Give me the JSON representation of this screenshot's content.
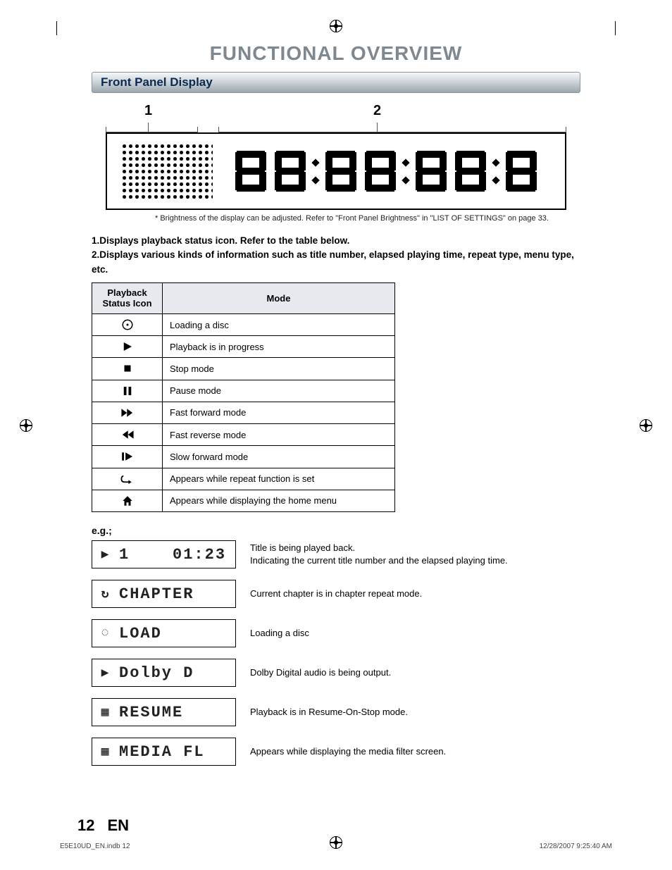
{
  "header": {
    "title": "FUNCTIONAL OVERVIEW"
  },
  "section": {
    "title": "Front Panel Display"
  },
  "diagram": {
    "labels": {
      "l1": "1",
      "l2": "2"
    }
  },
  "foot_note": "*  Brightness of the display can be adjusted. Refer to \"Front Panel Brightness\" in \"LIST OF SETTINGS\" on page 33.",
  "desc_list": {
    "item1": "1.Displays playback status icon. Refer to the table below.",
    "item2": "2.Displays various kinds of information such as title number, elapsed playing time, repeat type, menu type, etc."
  },
  "table": {
    "head": {
      "icon": "Playback Status Icon",
      "mode": "Mode"
    },
    "rows": [
      {
        "icon": "loading",
        "mode": "Loading a disc"
      },
      {
        "icon": "play",
        "mode": "Playback is in progress"
      },
      {
        "icon": "stop",
        "mode": "Stop mode"
      },
      {
        "icon": "pause",
        "mode": "Pause mode"
      },
      {
        "icon": "ff",
        "mode": "Fast forward mode"
      },
      {
        "icon": "rew",
        "mode": "Fast reverse mode"
      },
      {
        "icon": "slow",
        "mode": "Slow forward mode"
      },
      {
        "icon": "repeat",
        "mode": "Appears while repeat function is set"
      },
      {
        "icon": "home",
        "mode": "Appears while displaying the home menu"
      }
    ]
  },
  "eg_head": "e.g.;",
  "examples": [
    {
      "icon": "play-dot",
      "text": "1    01:23",
      "desc1": "Title is being played back.",
      "desc2": "Indicating the current title number and the elapsed playing time."
    },
    {
      "icon": "repeat-dot",
      "text": "CHAPTER",
      "desc1": "Current chapter is in chapter repeat mode.",
      "desc2": ""
    },
    {
      "icon": "loading-dot",
      "text": "LOAD",
      "desc1": "Loading a disc",
      "desc2": ""
    },
    {
      "icon": "play-dot",
      "text": "Dolby D",
      "desc1": "Dolby Digital audio is being output.",
      "desc2": ""
    },
    {
      "icon": "stop-dot",
      "text": "RESUME",
      "desc1": "Playback is in Resume-On-Stop mode.",
      "desc2": ""
    },
    {
      "icon": "stop-dot",
      "text": "MEDIA FL",
      "desc1": "Appears while displaying the media filter screen.",
      "desc2": ""
    }
  ],
  "page_footer": {
    "num": "12",
    "lang": "EN"
  },
  "print_footer": {
    "file": "E5E10UD_EN.indb   12",
    "date": "12/28/2007   9:25:40 AM"
  }
}
